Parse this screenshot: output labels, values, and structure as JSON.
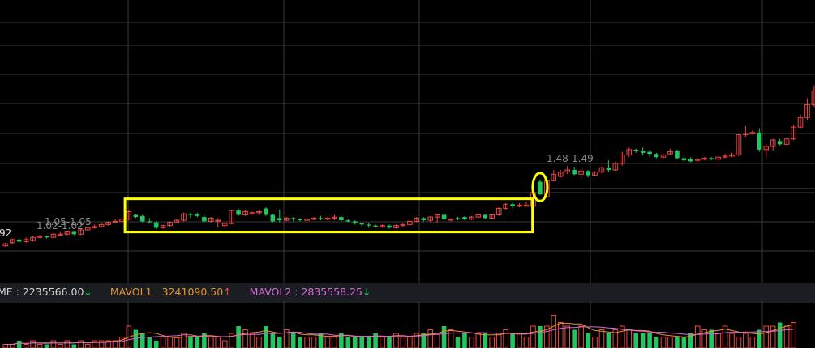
{
  "chart_data": {
    "type": "candlestick",
    "price_range": [
      0.6,
      3.25
    ],
    "colors": {
      "up": "#ef4444",
      "down": "#22c55e",
      "highlight": "#ffff00",
      "background": "#000000",
      "grid": "#3a3a3a",
      "mavol1": "#e8922f",
      "mavol2": "#d66bd6"
    },
    "annotations": {
      "left_price": "92",
      "low_label_1": "1.05-1.05",
      "low_label_2": "1.02-1.02",
      "price_line_label": "1.48-1.49",
      "price_line_value": 1.485
    },
    "highlight_box": {
      "from_index": 18,
      "to_index": 76
    },
    "highlight_ellipse_index": 78,
    "candles": [
      {
        "o": 0.95,
        "c": 0.97,
        "h": 0.98,
        "l": 0.94
      },
      {
        "o": 0.98,
        "c": 1.01,
        "h": 1.02,
        "l": 0.97
      },
      {
        "o": 1.01,
        "c": 0.99,
        "h": 1.02,
        "l": 0.98
      },
      {
        "o": 0.99,
        "c": 1.01,
        "h": 1.03,
        "l": 0.98
      },
      {
        "o": 1.0,
        "c": 1.03,
        "h": 1.04,
        "l": 0.99
      },
      {
        "o": 1.03,
        "c": 1.04,
        "h": 1.05,
        "l": 1.02
      },
      {
        "o": 1.04,
        "c": 1.03,
        "h": 1.05,
        "l": 1.02
      },
      {
        "o": 1.03,
        "c": 1.06,
        "h": 1.07,
        "l": 1.02
      },
      {
        "o": 1.06,
        "c": 1.06,
        "h": 1.08,
        "l": 1.05
      },
      {
        "o": 1.06,
        "c": 1.08,
        "h": 1.09,
        "l": 1.05
      },
      {
        "o": 1.08,
        "c": 1.06,
        "h": 1.09,
        "l": 1.05
      },
      {
        "o": 1.06,
        "c": 1.1,
        "h": 1.11,
        "l": 1.05
      },
      {
        "o": 1.1,
        "c": 1.12,
        "h": 1.13,
        "l": 1.09
      },
      {
        "o": 1.12,
        "c": 1.13,
        "h": 1.15,
        "l": 1.11
      },
      {
        "o": 1.13,
        "c": 1.15,
        "h": 1.16,
        "l": 1.12
      },
      {
        "o": 1.15,
        "c": 1.17,
        "h": 1.18,
        "l": 1.14
      },
      {
        "o": 1.17,
        "c": 1.18,
        "h": 1.2,
        "l": 1.16
      },
      {
        "o": 1.18,
        "c": 1.2,
        "h": 1.21,
        "l": 1.17
      },
      {
        "o": 1.2,
        "c": 1.27,
        "h": 1.29,
        "l": 1.19
      },
      {
        "o": 1.24,
        "c": 1.22,
        "h": 1.25,
        "l": 1.21
      },
      {
        "o": 1.23,
        "c": 1.18,
        "h": 1.24,
        "l": 1.17
      },
      {
        "o": 1.18,
        "c": 1.17,
        "h": 1.21,
        "l": 1.16
      },
      {
        "o": 1.17,
        "c": 1.12,
        "h": 1.18,
        "l": 1.11
      },
      {
        "o": 1.12,
        "c": 1.14,
        "h": 1.15,
        "l": 1.11
      },
      {
        "o": 1.14,
        "c": 1.17,
        "h": 1.18,
        "l": 1.13
      },
      {
        "o": 1.17,
        "c": 1.19,
        "h": 1.2,
        "l": 1.16
      },
      {
        "o": 1.19,
        "c": 1.25,
        "h": 1.26,
        "l": 1.18
      },
      {
        "o": 1.25,
        "c": 1.24,
        "h": 1.26,
        "l": 1.21
      },
      {
        "o": 1.25,
        "c": 1.23,
        "h": 1.26,
        "l": 1.22
      },
      {
        "o": 1.22,
        "c": 1.18,
        "h": 1.24,
        "l": 1.17
      },
      {
        "o": 1.18,
        "c": 1.21,
        "h": 1.22,
        "l": 1.17
      },
      {
        "o": 1.19,
        "c": 1.19,
        "h": 1.21,
        "l": 1.12
      },
      {
        "o": 1.14,
        "c": 1.16,
        "h": 1.17,
        "l": 1.13
      },
      {
        "o": 1.16,
        "c": 1.28,
        "h": 1.29,
        "l": 1.15
      },
      {
        "o": 1.28,
        "c": 1.24,
        "h": 1.3,
        "l": 1.23
      },
      {
        "o": 1.24,
        "c": 1.27,
        "h": 1.29,
        "l": 1.23
      },
      {
        "o": 1.25,
        "c": 1.26,
        "h": 1.27,
        "l": 1.24
      },
      {
        "o": 1.26,
        "c": 1.27,
        "h": 1.28,
        "l": 1.24
      },
      {
        "o": 1.3,
        "c": 1.24,
        "h": 1.31,
        "l": 1.23
      },
      {
        "o": 1.24,
        "c": 1.18,
        "h": 1.25,
        "l": 1.17
      },
      {
        "o": 1.21,
        "c": 1.19,
        "h": 1.29,
        "l": 1.17
      },
      {
        "o": 1.19,
        "c": 1.21,
        "h": 1.22,
        "l": 1.18
      },
      {
        "o": 1.21,
        "c": 1.2,
        "h": 1.22,
        "l": 1.18
      },
      {
        "o": 1.2,
        "c": 1.19,
        "h": 1.21,
        "l": 1.18
      },
      {
        "o": 1.19,
        "c": 1.2,
        "h": 1.21,
        "l": 1.18
      },
      {
        "o": 1.2,
        "c": 1.21,
        "h": 1.22,
        "l": 1.19
      },
      {
        "o": 1.21,
        "c": 1.2,
        "h": 1.23,
        "l": 1.19
      },
      {
        "o": 1.2,
        "c": 1.21,
        "h": 1.22,
        "l": 1.19
      },
      {
        "o": 1.21,
        "c": 1.22,
        "h": 1.24,
        "l": 1.19
      },
      {
        "o": 1.22,
        "c": 1.19,
        "h": 1.23,
        "l": 1.18
      },
      {
        "o": 1.19,
        "c": 1.18,
        "h": 1.2,
        "l": 1.17
      },
      {
        "o": 1.18,
        "c": 1.16,
        "h": 1.19,
        "l": 1.15
      },
      {
        "o": 1.16,
        "c": 1.15,
        "h": 1.17,
        "l": 1.13
      },
      {
        "o": 1.15,
        "c": 1.14,
        "h": 1.16,
        "l": 1.12
      },
      {
        "o": 1.14,
        "c": 1.13,
        "h": 1.15,
        "l": 1.12
      },
      {
        "o": 1.13,
        "c": 1.14,
        "h": 1.15,
        "l": 1.12
      },
      {
        "o": 1.14,
        "c": 1.12,
        "h": 1.15,
        "l": 1.11
      },
      {
        "o": 1.12,
        "c": 1.14,
        "h": 1.15,
        "l": 1.11
      },
      {
        "o": 1.14,
        "c": 1.15,
        "h": 1.16,
        "l": 1.13
      },
      {
        "o": 1.15,
        "c": 1.18,
        "h": 1.19,
        "l": 1.14
      },
      {
        "o": 1.18,
        "c": 1.21,
        "h": 1.22,
        "l": 1.17
      },
      {
        "o": 1.21,
        "c": 1.19,
        "h": 1.22,
        "l": 1.18
      },
      {
        "o": 1.19,
        "c": 1.22,
        "h": 1.23,
        "l": 1.17
      },
      {
        "o": 1.22,
        "c": 1.24,
        "h": 1.25,
        "l": 1.16
      },
      {
        "o": 1.24,
        "c": 1.2,
        "h": 1.25,
        "l": 1.19
      },
      {
        "o": 1.2,
        "c": 1.2,
        "h": 1.21,
        "l": 1.18
      },
      {
        "o": 1.21,
        "c": 1.2,
        "h": 1.22,
        "l": 1.19
      },
      {
        "o": 1.22,
        "c": 1.2,
        "h": 1.23,
        "l": 1.19
      },
      {
        "o": 1.2,
        "c": 1.22,
        "h": 1.23,
        "l": 1.19
      },
      {
        "o": 1.22,
        "c": 1.24,
        "h": 1.25,
        "l": 1.21
      },
      {
        "o": 1.24,
        "c": 1.21,
        "h": 1.25,
        "l": 1.2
      },
      {
        "o": 1.21,
        "c": 1.24,
        "h": 1.25,
        "l": 1.2
      },
      {
        "o": 1.24,
        "c": 1.3,
        "h": 1.31,
        "l": 1.23
      },
      {
        "o": 1.3,
        "c": 1.34,
        "h": 1.35,
        "l": 1.29
      },
      {
        "o": 1.34,
        "c": 1.32,
        "h": 1.36,
        "l": 1.3
      },
      {
        "o": 1.32,
        "c": 1.33,
        "h": 1.35,
        "l": 1.31
      },
      {
        "o": 1.33,
        "c": 1.33,
        "h": 1.36,
        "l": 1.32
      },
      {
        "o": 1.32,
        "c": 1.45,
        "h": 1.46,
        "l": 1.3
      },
      {
        "o": 1.55,
        "c": 1.43,
        "h": 1.57,
        "l": 1.43
      },
      {
        "o": 1.41,
        "c": 1.56,
        "h": 1.58,
        "l": 1.4
      },
      {
        "o": 1.56,
        "c": 1.62,
        "h": 1.66,
        "l": 1.55
      },
      {
        "o": 1.6,
        "c": 1.64,
        "h": 1.66,
        "l": 1.59
      },
      {
        "o": 1.64,
        "c": 1.66,
        "h": 1.7,
        "l": 1.62
      },
      {
        "o": 1.66,
        "c": 1.62,
        "h": 1.69,
        "l": 1.61
      },
      {
        "o": 1.62,
        "c": 1.65,
        "h": 1.67,
        "l": 1.58
      },
      {
        "o": 1.65,
        "c": 1.61,
        "h": 1.66,
        "l": 1.59
      },
      {
        "o": 1.61,
        "c": 1.64,
        "h": 1.65,
        "l": 1.6
      },
      {
        "o": 1.64,
        "c": 1.68,
        "h": 1.69,
        "l": 1.63
      },
      {
        "o": 1.68,
        "c": 1.66,
        "h": 1.75,
        "l": 1.64
      },
      {
        "o": 1.66,
        "c": 1.72,
        "h": 1.74,
        "l": 1.65
      },
      {
        "o": 1.72,
        "c": 1.8,
        "h": 1.83,
        "l": 1.7
      },
      {
        "o": 1.8,
        "c": 1.85,
        "h": 1.87,
        "l": 1.78
      },
      {
        "o": 1.85,
        "c": 1.84,
        "h": 1.86,
        "l": 1.82
      },
      {
        "o": 1.84,
        "c": 1.82,
        "h": 1.87,
        "l": 1.8
      },
      {
        "o": 1.83,
        "c": 1.81,
        "h": 1.85,
        "l": 1.78
      },
      {
        "o": 1.81,
        "c": 1.78,
        "h": 1.82,
        "l": 1.77
      },
      {
        "o": 1.78,
        "c": 1.8,
        "h": 1.81,
        "l": 1.77
      },
      {
        "o": 1.81,
        "c": 1.83,
        "h": 1.86,
        "l": 1.8
      },
      {
        "o": 1.84,
        "c": 1.77,
        "h": 1.85,
        "l": 1.76
      },
      {
        "o": 1.77,
        "c": 1.75,
        "h": 1.79,
        "l": 1.73
      },
      {
        "o": 1.76,
        "c": 1.74,
        "h": 1.78,
        "l": 1.73
      },
      {
        "o": 1.75,
        "c": 1.76,
        "h": 1.77,
        "l": 1.74
      },
      {
        "o": 1.76,
        "c": 1.77,
        "h": 1.78,
        "l": 1.75
      },
      {
        "o": 1.77,
        "c": 1.76,
        "h": 1.78,
        "l": 1.75
      },
      {
        "o": 1.76,
        "c": 1.78,
        "h": 1.79,
        "l": 1.75
      },
      {
        "o": 1.78,
        "c": 1.79,
        "h": 1.81,
        "l": 1.77
      },
      {
        "o": 1.79,
        "c": 1.8,
        "h": 1.82,
        "l": 1.78
      },
      {
        "o": 1.8,
        "c": 1.99,
        "h": 2.0,
        "l": 1.79
      },
      {
        "o": 1.99,
        "c": 2.0,
        "h": 2.07,
        "l": 1.97
      },
      {
        "o": 2.0,
        "c": 2.01,
        "h": 2.03,
        "l": 1.99
      },
      {
        "o": 2.01,
        "c": 1.85,
        "h": 2.05,
        "l": 1.83
      },
      {
        "o": 1.85,
        "c": 1.88,
        "h": 1.9,
        "l": 1.78
      },
      {
        "o": 1.88,
        "c": 1.94,
        "h": 1.95,
        "l": 1.84
      },
      {
        "o": 1.93,
        "c": 1.9,
        "h": 1.95,
        "l": 1.89
      },
      {
        "o": 1.9,
        "c": 1.95,
        "h": 1.96,
        "l": 1.88
      },
      {
        "o": 1.95,
        "c": 2.06,
        "h": 2.08,
        "l": 1.94
      },
      {
        "o": 2.06,
        "c": 2.15,
        "h": 2.18,
        "l": 2.05
      },
      {
        "o": 2.15,
        "c": 2.27,
        "h": 2.33,
        "l": 2.13
      },
      {
        "o": 2.27,
        "c": 2.4,
        "h": 2.45,
        "l": 2.25
      },
      {
        "o": 2.4,
        "c": 2.55,
        "h": 2.58,
        "l": 2.38
      },
      {
        "o": 2.55,
        "c": 2.45,
        "h": 2.62,
        "l": 2.44
      }
    ],
    "volume": {
      "label": "ME : 2235566.00",
      "label_arrow": "↓",
      "mavol1_label": "MAVOL1 : 3241090.50",
      "mavol1_arrow": "↑",
      "mavol2_label": "MAVOL2 : 2835558.25",
      "mavol2_arrow": "↓",
      "bars": [
        1,
        1,
        2,
        1,
        2,
        1,
        1,
        2,
        1,
        2,
        1,
        2,
        1,
        2,
        2,
        2,
        2,
        3,
        6,
        5,
        4,
        3,
        2,
        3,
        3,
        3,
        4,
        3,
        3,
        4,
        3,
        3,
        2,
        4,
        6,
        5,
        4,
        3,
        6,
        4,
        3,
        5,
        4,
        3,
        3,
        3,
        4,
        3,
        3,
        4,
        3,
        3,
        3,
        3,
        4,
        3,
        3,
        4,
        3,
        3,
        4,
        4,
        5,
        4,
        6,
        5,
        3,
        4,
        3,
        4,
        4,
        3,
        4,
        5,
        4,
        4,
        3,
        6,
        6,
        6,
        9,
        7,
        6,
        5,
        6,
        4,
        3,
        5,
        4,
        5,
        6,
        5,
        4,
        4,
        4,
        3,
        3,
        3,
        3,
        3,
        4,
        6,
        5,
        5,
        4,
        6,
        4,
        3,
        4,
        3,
        5,
        6,
        6,
        7,
        6,
        7
      ]
    }
  }
}
